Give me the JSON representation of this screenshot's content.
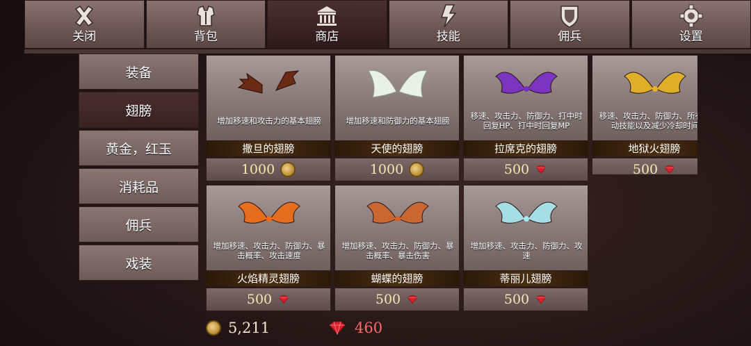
{
  "tabs": [
    {
      "label": "关闭",
      "icon": "close-icon"
    },
    {
      "label": "背包",
      "icon": "armor-icon"
    },
    {
      "label": "商店",
      "icon": "shop-icon",
      "active": true
    },
    {
      "label": "技能",
      "icon": "lightning-icon"
    },
    {
      "label": "佣兵",
      "icon": "shield-icon"
    },
    {
      "label": "设置",
      "icon": "gear-icon"
    }
  ],
  "categories": [
    {
      "label": "装备"
    },
    {
      "label": "翅膀",
      "active": true
    },
    {
      "label": "黄金，红玉"
    },
    {
      "label": "消耗品"
    },
    {
      "label": "佣兵"
    },
    {
      "label": "戏装"
    }
  ],
  "items": [
    {
      "name": "撒旦的翅膀",
      "desc": "增加移速和攻击力的基本翅膀",
      "price": "1000",
      "currency": "coin",
      "wing": "bat-wings-icon",
      "color": "#6a2a14"
    },
    {
      "name": "天使的翅膀",
      "desc": "增加移速和防御力的基本翅膀",
      "price": "1000",
      "currency": "coin",
      "wing": "angel-wings-icon",
      "color": "#e8f0e8"
    },
    {
      "name": "拉席克的翅膀",
      "desc": "移速、攻击力、防御力、打中时回复HP、打中时回复MP",
      "price": "500",
      "currency": "gem",
      "wing": "purple-wings-icon",
      "color": "#7a2cc8"
    },
    {
      "name": "地狱火翅膀",
      "desc": "移速、攻击力、防御力、所有主动技能以及减少冷却时间",
      "price": "500",
      "currency": "gem",
      "wing": "golden-wings-icon",
      "color": "#e8b420"
    },
    {
      "name": "火焰精灵翅膀",
      "desc": "增加移速、攻击力、防御力、暴击概率、攻击速度",
      "price": "500",
      "currency": "gem",
      "wing": "fire-wings-icon",
      "color": "#f06a14"
    },
    {
      "name": "蝴蝶的翅膀",
      "desc": "增加移速、攻击力、防御力、暴击概率、暴击伤害",
      "price": "500",
      "currency": "gem",
      "wing": "butterfly-wings-icon",
      "color": "#d0642a"
    },
    {
      "name": "蒂丽儿翅膀",
      "desc": "增加移速、攻击力、防御力、攻速",
      "price": "500",
      "currency": "gem",
      "wing": "ice-wings-icon",
      "color": "#a8e8f0"
    }
  ],
  "wallet": {
    "coins": "5,211",
    "gems": "460"
  },
  "colors": {
    "gem": "#d8202a",
    "coin": "#c89a40",
    "gemText": "#ff6a6a"
  }
}
